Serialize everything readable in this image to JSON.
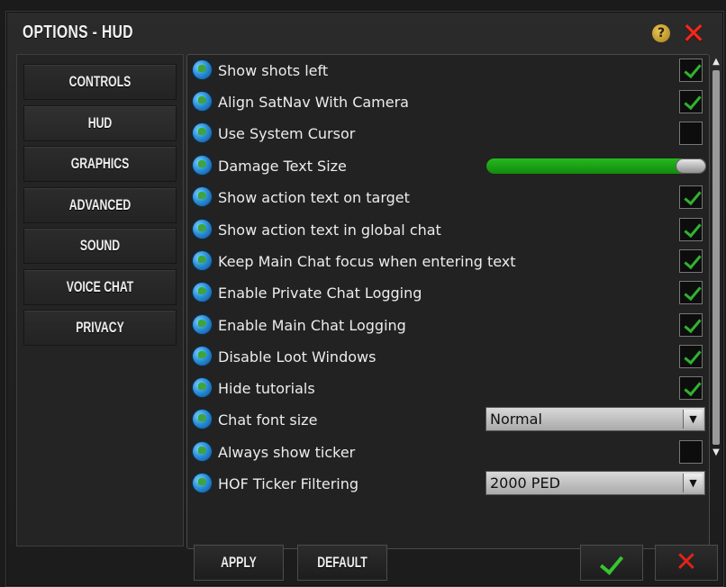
{
  "window": {
    "title": "OPTIONS - HUD"
  },
  "titlebar": {
    "help_glyph": "?",
    "help_icon": "help-icon",
    "close_glyph": "✕",
    "close_icon": "close-icon"
  },
  "sidebar": {
    "items": [
      {
        "label": "CONTROLS",
        "active": false
      },
      {
        "label": "HUD",
        "active": true
      },
      {
        "label": "GRAPHICS",
        "active": false
      },
      {
        "label": "ADVANCED",
        "active": false
      },
      {
        "label": "SOUND",
        "active": false
      },
      {
        "label": "VOICE CHAT",
        "active": false
      },
      {
        "label": "PRIVACY",
        "active": false
      }
    ]
  },
  "settings": {
    "rows": [
      {
        "label": "Show shots left",
        "control": "checkbox",
        "checked": true
      },
      {
        "label": "Align SatNav With Camera",
        "control": "checkbox",
        "checked": true
      },
      {
        "label": "Use System Cursor",
        "control": "checkbox",
        "checked": false
      },
      {
        "label": "Damage Text Size",
        "control": "slider",
        "level": 1.0
      },
      {
        "label": "Show action text on target",
        "control": "checkbox",
        "checked": true
      },
      {
        "label": "Show action text in global chat",
        "control": "checkbox",
        "checked": true
      },
      {
        "label": "Keep Main Chat focus when entering text",
        "control": "checkbox",
        "checked": true
      },
      {
        "label": "Enable Private Chat Logging",
        "control": "checkbox",
        "checked": true
      },
      {
        "label": "Enable Main Chat Logging",
        "control": "checkbox",
        "checked": true
      },
      {
        "label": "Disable Loot Windows",
        "control": "checkbox",
        "checked": true
      },
      {
        "label": "Hide tutorials",
        "control": "checkbox",
        "checked": true
      },
      {
        "label": "Chat font size",
        "control": "select",
        "value": "Normal"
      },
      {
        "label": "Always show ticker",
        "control": "checkbox",
        "checked": false
      },
      {
        "label": "HOF Ticker Filtering",
        "control": "select",
        "value": "2000 PED"
      }
    ],
    "row_icon": "globe-icon"
  },
  "footer": {
    "apply_label": "APPLY",
    "default_label": "DEFAULT",
    "confirm_icon": "checkmark-icon",
    "cancel_icon": "cancel-x-icon"
  },
  "colors": {
    "checkmark": "#2fb32f",
    "slider_fill": "#27b81f",
    "close_red": "#ef2a1e",
    "panel_bg": "#222222"
  }
}
